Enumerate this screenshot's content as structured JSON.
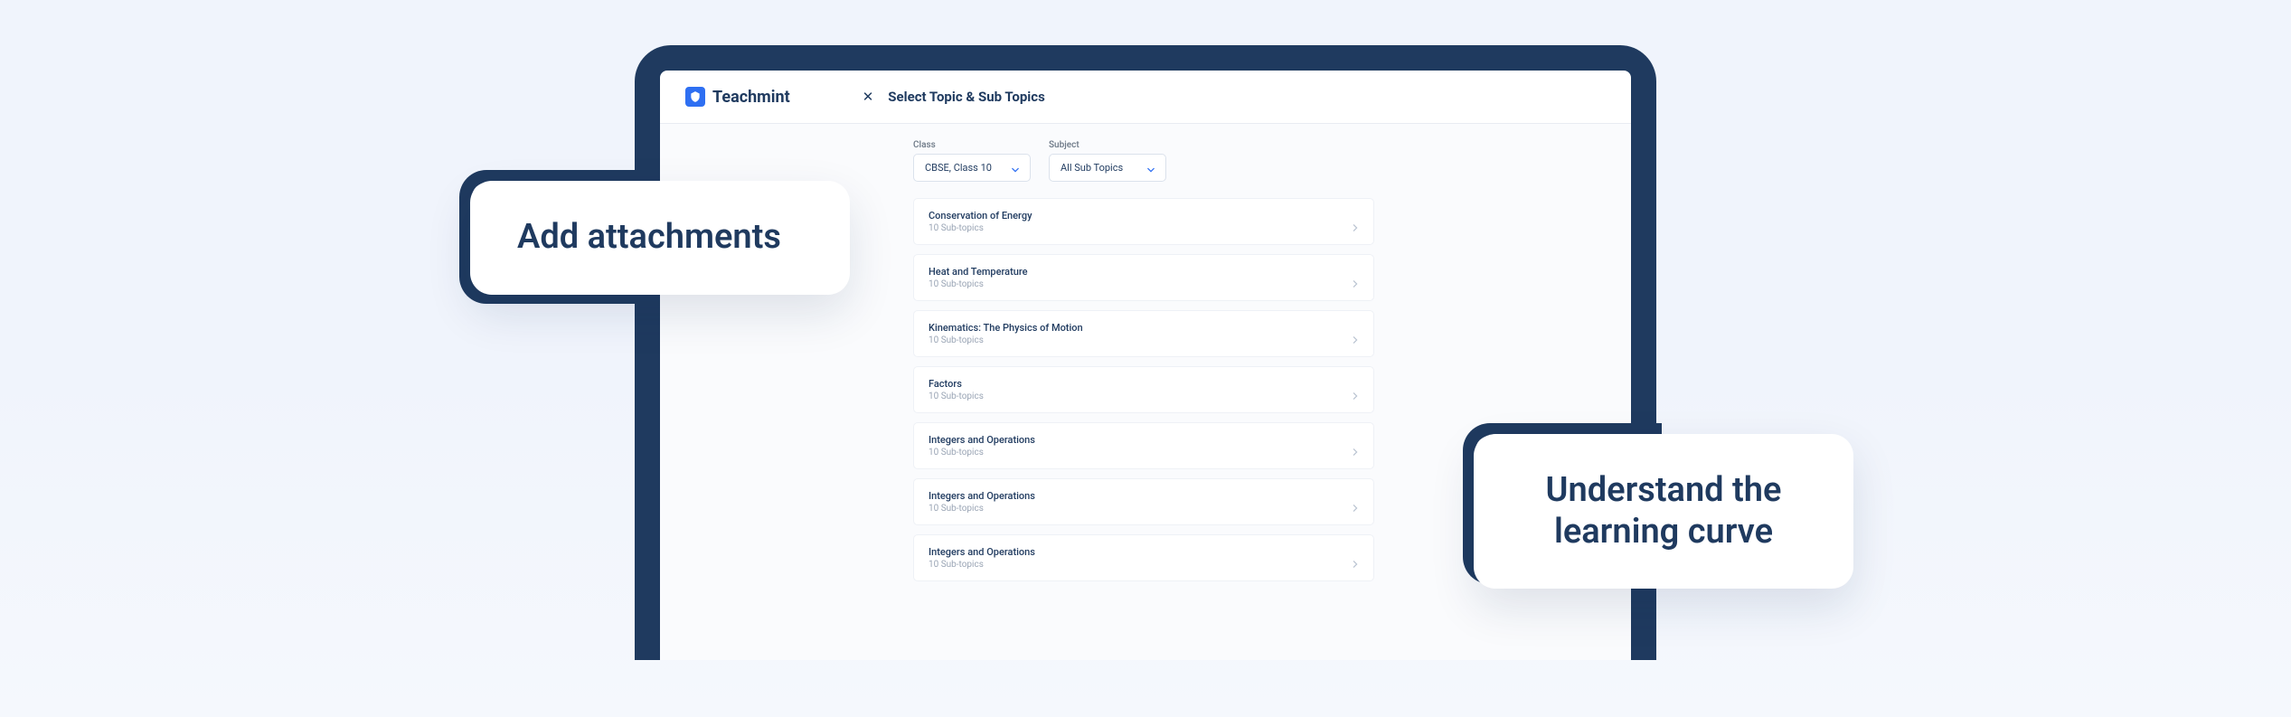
{
  "brand": {
    "name": "Teachmint"
  },
  "header": {
    "title": "Select Topic & Sub Topics"
  },
  "filters": {
    "class": {
      "label": "Class",
      "value": "CBSE, Class 10"
    },
    "subject": {
      "label": "Subject",
      "value": "All Sub Topics"
    }
  },
  "topics": [
    {
      "title": "Conservation of Energy",
      "subtitle": "10 Sub-topics"
    },
    {
      "title": "Heat and Temperature",
      "subtitle": "10 Sub-topics"
    },
    {
      "title": "Kinematics: The Physics of Motion",
      "subtitle": "10 Sub-topics"
    },
    {
      "title": "Factors",
      "subtitle": "10 Sub-topics"
    },
    {
      "title": "Integers and Operations",
      "subtitle": "10 Sub-topics"
    },
    {
      "title": "Integers and Operations",
      "subtitle": "10 Sub-topics"
    },
    {
      "title": "Integers and Operations",
      "subtitle": "10 Sub-topics"
    }
  ],
  "callouts": {
    "left": "Add attachments",
    "right": "Understand the learning curve"
  }
}
